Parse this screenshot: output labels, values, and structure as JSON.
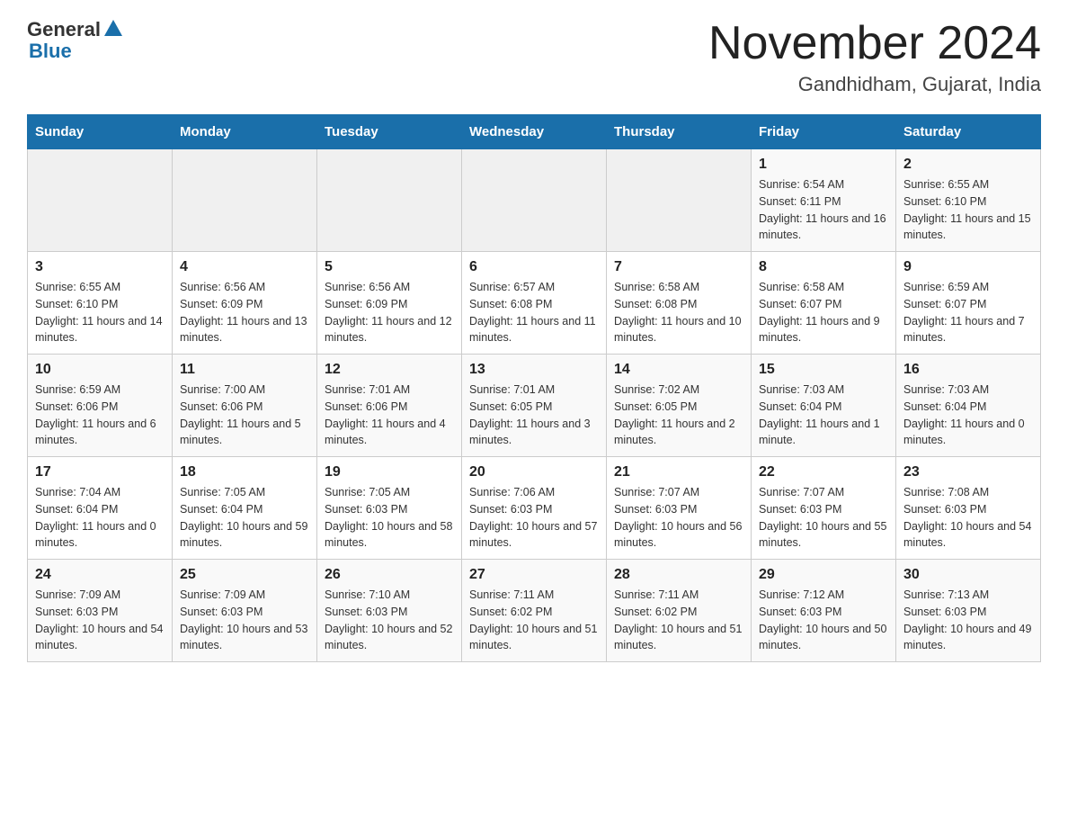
{
  "header": {
    "logo_general": "General",
    "logo_blue": "Blue",
    "month_title": "November 2024",
    "location": "Gandhidham, Gujarat, India"
  },
  "weekdays": [
    "Sunday",
    "Monday",
    "Tuesday",
    "Wednesday",
    "Thursday",
    "Friday",
    "Saturday"
  ],
  "weeks": [
    [
      {
        "day": "",
        "info": ""
      },
      {
        "day": "",
        "info": ""
      },
      {
        "day": "",
        "info": ""
      },
      {
        "day": "",
        "info": ""
      },
      {
        "day": "",
        "info": ""
      },
      {
        "day": "1",
        "info": "Sunrise: 6:54 AM\nSunset: 6:11 PM\nDaylight: 11 hours and 16 minutes."
      },
      {
        "day": "2",
        "info": "Sunrise: 6:55 AM\nSunset: 6:10 PM\nDaylight: 11 hours and 15 minutes."
      }
    ],
    [
      {
        "day": "3",
        "info": "Sunrise: 6:55 AM\nSunset: 6:10 PM\nDaylight: 11 hours and 14 minutes."
      },
      {
        "day": "4",
        "info": "Sunrise: 6:56 AM\nSunset: 6:09 PM\nDaylight: 11 hours and 13 minutes."
      },
      {
        "day": "5",
        "info": "Sunrise: 6:56 AM\nSunset: 6:09 PM\nDaylight: 11 hours and 12 minutes."
      },
      {
        "day": "6",
        "info": "Sunrise: 6:57 AM\nSunset: 6:08 PM\nDaylight: 11 hours and 11 minutes."
      },
      {
        "day": "7",
        "info": "Sunrise: 6:58 AM\nSunset: 6:08 PM\nDaylight: 11 hours and 10 minutes."
      },
      {
        "day": "8",
        "info": "Sunrise: 6:58 AM\nSunset: 6:07 PM\nDaylight: 11 hours and 9 minutes."
      },
      {
        "day": "9",
        "info": "Sunrise: 6:59 AM\nSunset: 6:07 PM\nDaylight: 11 hours and 7 minutes."
      }
    ],
    [
      {
        "day": "10",
        "info": "Sunrise: 6:59 AM\nSunset: 6:06 PM\nDaylight: 11 hours and 6 minutes."
      },
      {
        "day": "11",
        "info": "Sunrise: 7:00 AM\nSunset: 6:06 PM\nDaylight: 11 hours and 5 minutes."
      },
      {
        "day": "12",
        "info": "Sunrise: 7:01 AM\nSunset: 6:06 PM\nDaylight: 11 hours and 4 minutes."
      },
      {
        "day": "13",
        "info": "Sunrise: 7:01 AM\nSunset: 6:05 PM\nDaylight: 11 hours and 3 minutes."
      },
      {
        "day": "14",
        "info": "Sunrise: 7:02 AM\nSunset: 6:05 PM\nDaylight: 11 hours and 2 minutes."
      },
      {
        "day": "15",
        "info": "Sunrise: 7:03 AM\nSunset: 6:04 PM\nDaylight: 11 hours and 1 minute."
      },
      {
        "day": "16",
        "info": "Sunrise: 7:03 AM\nSunset: 6:04 PM\nDaylight: 11 hours and 0 minutes."
      }
    ],
    [
      {
        "day": "17",
        "info": "Sunrise: 7:04 AM\nSunset: 6:04 PM\nDaylight: 11 hours and 0 minutes."
      },
      {
        "day": "18",
        "info": "Sunrise: 7:05 AM\nSunset: 6:04 PM\nDaylight: 10 hours and 59 minutes."
      },
      {
        "day": "19",
        "info": "Sunrise: 7:05 AM\nSunset: 6:03 PM\nDaylight: 10 hours and 58 minutes."
      },
      {
        "day": "20",
        "info": "Sunrise: 7:06 AM\nSunset: 6:03 PM\nDaylight: 10 hours and 57 minutes."
      },
      {
        "day": "21",
        "info": "Sunrise: 7:07 AM\nSunset: 6:03 PM\nDaylight: 10 hours and 56 minutes."
      },
      {
        "day": "22",
        "info": "Sunrise: 7:07 AM\nSunset: 6:03 PM\nDaylight: 10 hours and 55 minutes."
      },
      {
        "day": "23",
        "info": "Sunrise: 7:08 AM\nSunset: 6:03 PM\nDaylight: 10 hours and 54 minutes."
      }
    ],
    [
      {
        "day": "24",
        "info": "Sunrise: 7:09 AM\nSunset: 6:03 PM\nDaylight: 10 hours and 54 minutes."
      },
      {
        "day": "25",
        "info": "Sunrise: 7:09 AM\nSunset: 6:03 PM\nDaylight: 10 hours and 53 minutes."
      },
      {
        "day": "26",
        "info": "Sunrise: 7:10 AM\nSunset: 6:03 PM\nDaylight: 10 hours and 52 minutes."
      },
      {
        "day": "27",
        "info": "Sunrise: 7:11 AM\nSunset: 6:02 PM\nDaylight: 10 hours and 51 minutes."
      },
      {
        "day": "28",
        "info": "Sunrise: 7:11 AM\nSunset: 6:02 PM\nDaylight: 10 hours and 51 minutes."
      },
      {
        "day": "29",
        "info": "Sunrise: 7:12 AM\nSunset: 6:03 PM\nDaylight: 10 hours and 50 minutes."
      },
      {
        "day": "30",
        "info": "Sunrise: 7:13 AM\nSunset: 6:03 PM\nDaylight: 10 hours and 49 minutes."
      }
    ]
  ]
}
